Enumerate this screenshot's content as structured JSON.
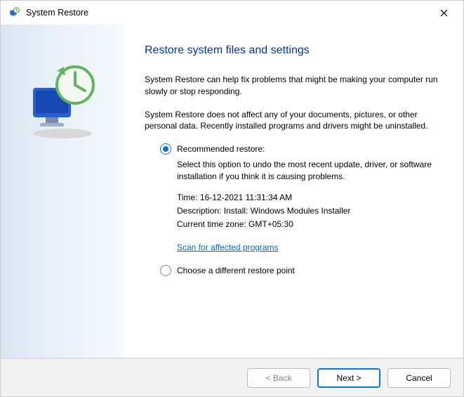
{
  "titlebar": {
    "title": "System Restore"
  },
  "main": {
    "heading": "Restore system files and settings",
    "intro1": "System Restore can help fix problems that might be making your computer run slowly or stop responding.",
    "intro2": "System Restore does not affect any of your documents, pictures, or other personal data. Recently installed programs and drivers might be uninstalled."
  },
  "options": {
    "recommended": {
      "label": "Recommended restore:",
      "desc": "Select this option to undo the most recent update, driver, or software installation if you think it is causing problems.",
      "time_line": "Time: 16-12-2021 11:31:34 AM",
      "description_line": "Description: Install: Windows Modules Installer",
      "timezone_line": "Current time zone: GMT+05:30",
      "scan_link": "Scan for affected programs"
    },
    "different": {
      "label": "Choose a different restore point"
    }
  },
  "footer": {
    "back": "< Back",
    "next": "Next >",
    "cancel": "Cancel"
  }
}
